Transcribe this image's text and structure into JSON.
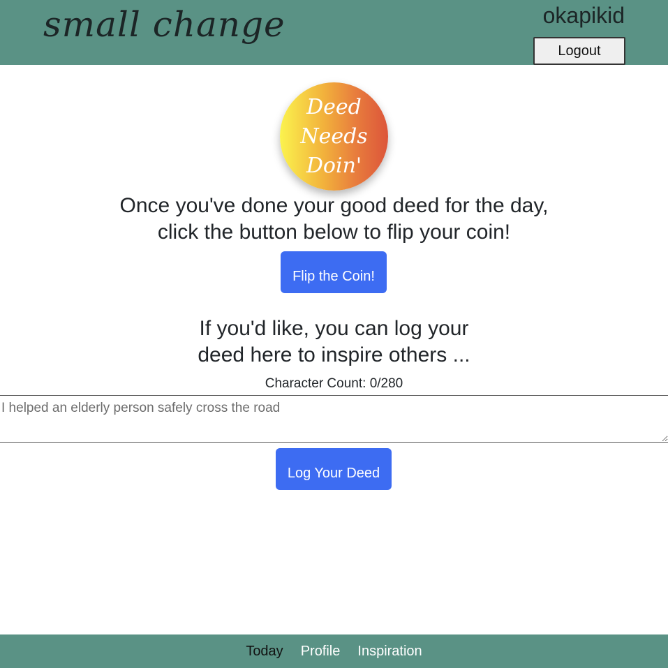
{
  "header": {
    "brand": "small change",
    "username": "okapikid",
    "logout_label": "Logout"
  },
  "coin": {
    "lines": [
      "Deed",
      "Needs",
      "Doin'"
    ]
  },
  "main": {
    "instruction_line1": "Once you've done your good deed for the day,",
    "instruction_line2": "click the button below to flip your coin!",
    "flip_label": "Flip the Coin!",
    "log_prompt_line1": "If you'd like, you can log your",
    "log_prompt_line2": "deed here to inspire others ...",
    "char_count": "Character Count: 0/280",
    "deed_placeholder": "I helped an elderly person safely cross the road",
    "log_label": "Log Your Deed"
  },
  "footer": {
    "nav": [
      {
        "label": "Today",
        "active": true
      },
      {
        "label": "Profile",
        "active": false
      },
      {
        "label": "Inspiration",
        "active": false
      }
    ]
  },
  "colors": {
    "header_bg": "#5a9285",
    "button_bg": "#3d6cf2",
    "footer_bg": "#5a9285"
  }
}
